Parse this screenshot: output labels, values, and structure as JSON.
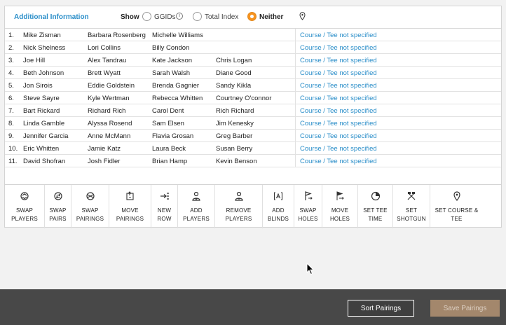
{
  "info": {
    "title": "Additional Information",
    "show_label": "Show",
    "options": [
      "GGIDs",
      "Total Index",
      "Neither"
    ],
    "selected": "Neither",
    "info_glyph": "i"
  },
  "pairings": [
    {
      "num": "1.",
      "p1": "Mike Zisman",
      "p2": "Barbara Rosenberg",
      "p3": "Michelle Williams",
      "p4": "",
      "course": "Course / Tee not specified"
    },
    {
      "num": "2.",
      "p1": "Nick Shelness",
      "p2": "Lori Collins",
      "p3": "Billy Condon",
      "p4": "",
      "course": "Course / Tee not specified"
    },
    {
      "num": "3.",
      "p1": "Joe Hill",
      "p2": "Alex Tandrau",
      "p3": "Kate Jackson",
      "p4": "Chris Logan",
      "course": "Course / Tee not specified"
    },
    {
      "num": "4.",
      "p1": "Beth Johnson",
      "p2": "Brett Wyatt",
      "p3": "Sarah Walsh",
      "p4": "Diane Good",
      "course": "Course / Tee not specified"
    },
    {
      "num": "5.",
      "p1": "Jon Sirois",
      "p2": "Eddie Goldstein",
      "p3": "Brenda Gagnier",
      "p4": "Sandy Kikla",
      "course": "Course / Tee not specified"
    },
    {
      "num": "6.",
      "p1": "Steve Sayre",
      "p2": "Kyle Wertman",
      "p3": "Rebecca Whitten",
      "p4": "Courtney O'connor",
      "course": "Course / Tee not specified"
    },
    {
      "num": "7.",
      "p1": "Bart Rickard",
      "p2": "Richard Rich",
      "p3": "Carol Dent",
      "p4": "Rich Richard",
      "course": "Course / Tee not specified"
    },
    {
      "num": "8.",
      "p1": "Linda Gamble",
      "p2": "Alyssa Rosend",
      "p3": "Sam Elsen",
      "p4": "Jim Kenesky",
      "course": "Course / Tee not specified"
    },
    {
      "num": "9.",
      "p1": "Jennifer Garcia",
      "p2": "Anne McMann",
      "p3": "Flavia Grosan",
      "p4": "Greg Barber",
      "course": "Course / Tee not specified"
    },
    {
      "num": "10.",
      "p1": "Eric Whitten",
      "p2": "Jamie Katz",
      "p3": "Laura Beck",
      "p4": "Susan Berry",
      "course": "Course / Tee not specified"
    },
    {
      "num": "11.",
      "p1": "David Shofran",
      "p2": "Josh Fidler",
      "p3": "Brian Hamp",
      "p4": "Kevin Benson",
      "course": "Course / Tee not specified"
    }
  ],
  "toolbar": [
    {
      "label": "SWAP\nPLAYERS",
      "icon": "swap-players-icon"
    },
    {
      "label": "SWAP\nPAIRS",
      "icon": "swap-pairs-icon"
    },
    {
      "label": "SWAP\nPAIRINGS",
      "icon": "swap-pairings-icon"
    },
    {
      "label": "MOVE\nPAIRINGS",
      "icon": "move-pairings-icon"
    },
    {
      "label": "NEW\nROW",
      "icon": "new-row-icon"
    },
    {
      "label": "ADD\nPLAYERS",
      "icon": "add-players-icon"
    },
    {
      "label": "REMOVE\nPLAYERS",
      "icon": "remove-players-icon"
    },
    {
      "label": "ADD\nBLINDS",
      "icon": "add-blinds-icon"
    },
    {
      "label": "SWAP\nHOLES",
      "icon": "swap-holes-icon"
    },
    {
      "label": "MOVE\nHOLES",
      "icon": "move-holes-icon"
    },
    {
      "label": "SET TEE\nTIME",
      "icon": "tee-time-icon"
    },
    {
      "label": "SET\nSHOTGUN",
      "icon": "shotgun-icon"
    },
    {
      "label": "SET COURSE &\nTEE",
      "icon": "location-pin-icon"
    }
  ],
  "footer": {
    "sort_label": "Sort Pairings",
    "save_label": "Save Pairings"
  },
  "colors": {
    "accent_blue": "#2a8ec9",
    "radio_selected": "#f7931e",
    "footer_bg": "#484848",
    "save_disabled": "#a3876c"
  }
}
